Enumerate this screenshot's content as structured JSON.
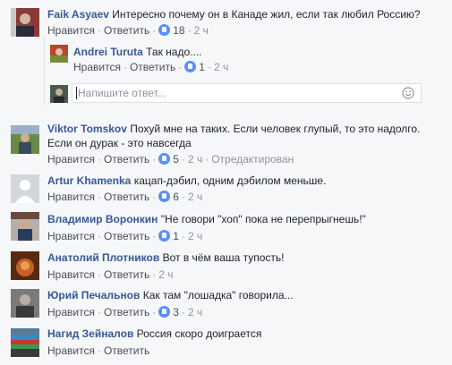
{
  "actions": {
    "like": "Нравится",
    "reply": "Ответить",
    "dot": "·"
  },
  "reply_box": {
    "placeholder": "Напишите ответ..."
  },
  "comments": [
    {
      "name": "Faik Asyaev",
      "text": "Интересно почему он в Канаде жил, если так любил Россию?",
      "likes": "18",
      "time": "2 ч",
      "avatar_color": "#7a2a2a"
    },
    {
      "name": "Andrei Turuta",
      "text": "Так надо....",
      "likes": "1",
      "time": "2 ч",
      "avatar_color": "#c44a3a"
    },
    {
      "name": "Viktor Tomskov",
      "text": "Похуй мне на таких. Если человек глупый, то это надолго.",
      "text2": "Если он дурак - это навсегда",
      "likes": "5",
      "time": "2 ч",
      "edited": "Отредактирован",
      "avatar_color": "#4a6a3a"
    },
    {
      "name": "Artur Khamenka",
      "text": "кацап-дэбил, одним дэбилом меньше.",
      "likes": "6",
      "time": "2 ч",
      "avatar_color": "#d3d6db"
    },
    {
      "name": "Владимир Воронкин",
      "text": "\"Не говори \"хоп\" пока не перепрыгнешь!\"",
      "likes": "1",
      "time": "2 ч",
      "avatar_color": "#4a4a5a"
    },
    {
      "name": "Анатолий Плотников",
      "text": "Вот в чём ваша тупость!",
      "time": "2 ч",
      "avatar_color": "#8a3a1a"
    },
    {
      "name": "Юрий Печальнов",
      "text": "Как там \"лошадка\" говорила...",
      "likes": "3",
      "time": "2 ч",
      "avatar_color": "#6a6a6a"
    },
    {
      "name": "Нагид Зейналов",
      "text": "Россия скоро доиграется",
      "avatar_color": "#2a5a8a"
    }
  ],
  "reply_avatar_color": "#3a4a3a"
}
